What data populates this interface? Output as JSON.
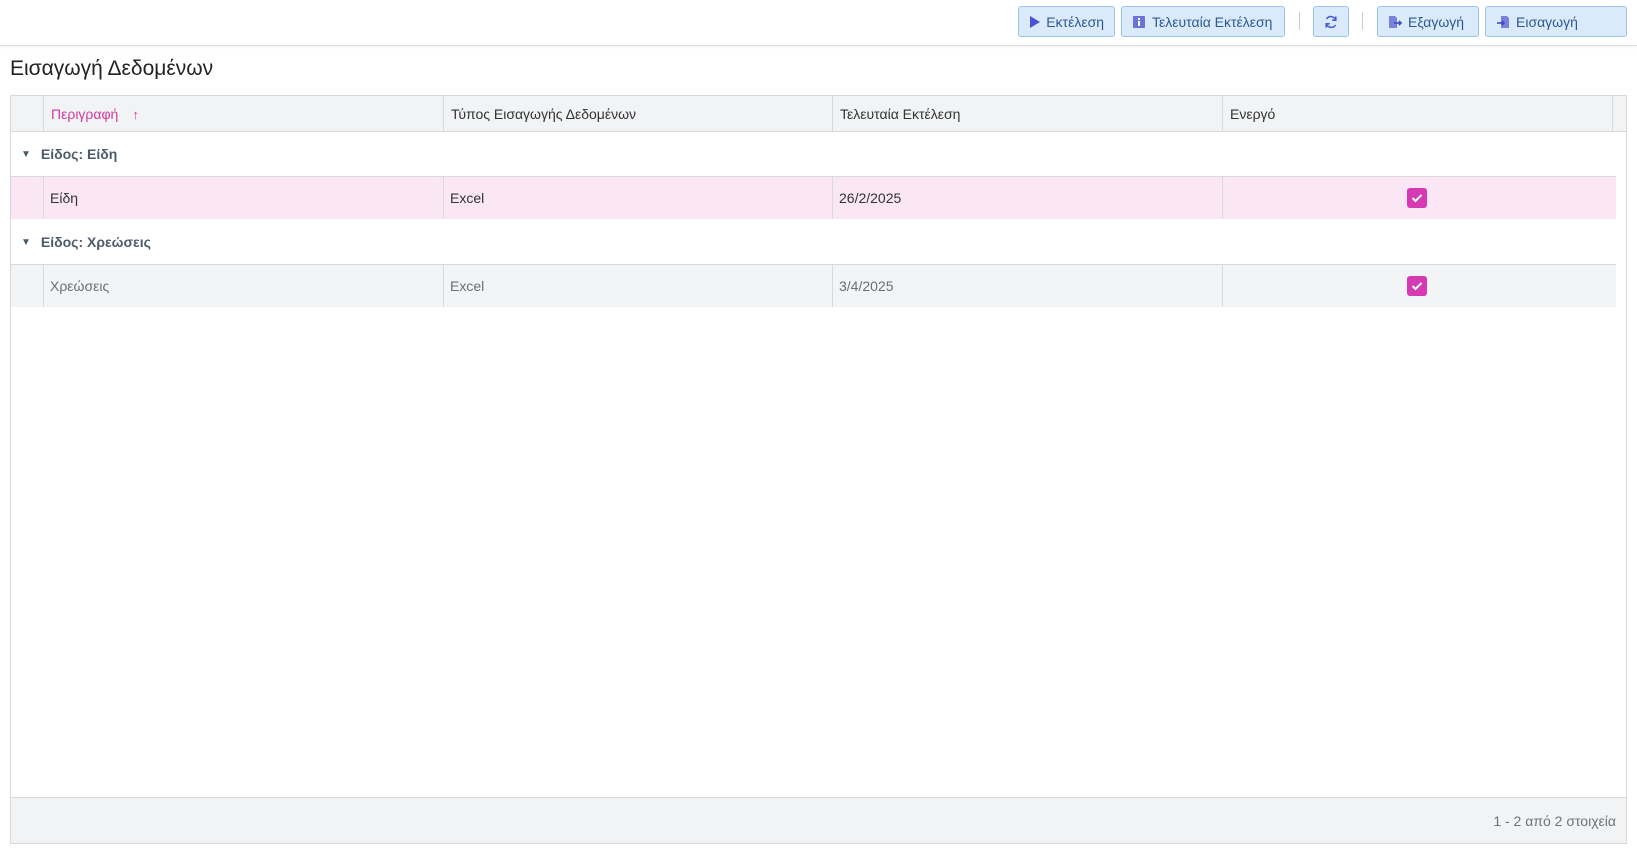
{
  "toolbar": {
    "run_label": "Εκτέλεση",
    "last_run_label": "Τελευταία Εκτέλεση",
    "refresh_icon": "refresh-icon",
    "export_label": "Εξαγωγή",
    "import_label": "Εισαγωγή"
  },
  "page": {
    "title": "Εισαγωγή Δεδομένων"
  },
  "grid": {
    "columns": [
      "Περιγραφή",
      "Τύπος Εισαγωγής Δεδομένων",
      "Τελευταία Εκτέλεση",
      "Ενεργό"
    ],
    "sort_indicator": "↑",
    "groups": [
      {
        "label": "Είδος: Είδη",
        "rows": [
          {
            "description": "Είδη",
            "type": "Excel",
            "last_run": "26/2/2025",
            "active": true,
            "selected": true
          }
        ]
      },
      {
        "label": "Είδος: Χρεώσεις",
        "rows": [
          {
            "description": "Χρεώσεις",
            "type": "Excel",
            "last_run": "3/4/2025",
            "active": true,
            "selected": false
          }
        ]
      }
    ],
    "pager_info": "1 - 2 από 2 στοιχεία"
  },
  "colors": {
    "accent": "#d63ab3",
    "button_bg": "#dbeafb",
    "selected_row": "#fae6f5"
  }
}
